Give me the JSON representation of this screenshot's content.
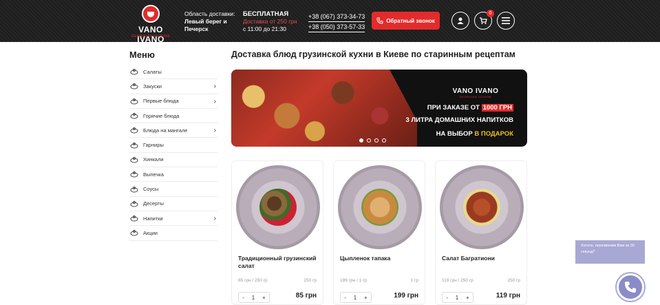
{
  "header": {
    "logo_text": "VANO IVANO",
    "logo_sub": "GEORGIAN CUISINE",
    "delivery_area_label": "Область доставки:",
    "delivery_area_value": "Левый берег и Печерск",
    "free_title": "БЕСПЛАТНАЯ",
    "free_condition": "Доставка от 250 грн",
    "free_hours": "с 11:00 до 21:30",
    "phone_1": "+38 (067) 373-34-73",
    "phone_2": "+38 (050) 373-57-33",
    "callback_label": "Обратный звонок",
    "cart_count": "0"
  },
  "sidebar": {
    "title": "Меню",
    "items": [
      {
        "label": "Салаты",
        "icon": "salad-icon",
        "arrow": false
      },
      {
        "label": "Закуски",
        "icon": "snacks-icon",
        "arrow": true
      },
      {
        "label": "Первые блюда",
        "icon": "soup-icon",
        "arrow": true
      },
      {
        "label": "Горячие блюда",
        "icon": "hot-dish-icon",
        "arrow": false
      },
      {
        "label": "Блюда на мангале",
        "icon": "grill-icon",
        "arrow": true
      },
      {
        "label": "Гарниры",
        "icon": "garnish-icon",
        "arrow": false
      },
      {
        "label": "Хинкали",
        "icon": "khinkali-icon",
        "arrow": false
      },
      {
        "label": "Выпечка",
        "icon": "pastry-icon",
        "arrow": false
      },
      {
        "label": "Соусы",
        "icon": "sauce-icon",
        "arrow": false
      },
      {
        "label": "Десерты",
        "icon": "dessert-icon",
        "arrow": false
      },
      {
        "label": "Напитки",
        "icon": "drinks-icon",
        "arrow": true
      },
      {
        "label": "Акции",
        "icon": "percent-icon",
        "arrow": false
      }
    ]
  },
  "main": {
    "title": "Доставка блюд грузинской кухни в Киеве по старинным рецептам"
  },
  "banner": {
    "logo_text": "VANO IVANO",
    "logo_sub": "GEORGIAN CUISINE",
    "line1_pre": "ПРИ ЗАКАЗЕ ОТ",
    "line1_hl": "1000 ГРН",
    "line2": "3 ЛИТРА ДОМАШНИХ НАПИТКОВ",
    "line3_pre": "НА ВЫБОР",
    "line3_hl": "В ПОДАРОК"
  },
  "products": [
    {
      "name": "Традиционный грузинский салат",
      "weight": "85 грн / 250 гр",
      "weight2": "250 гр",
      "qty": "1",
      "price": "85 грн"
    },
    {
      "name": "Цыпленок тапака",
      "weight": "199 грн / 1 гр",
      "weight2": "1 гр",
      "qty": "1",
      "price": "199 грн"
    },
    {
      "name": "Салат Багратиони",
      "weight": "119 грн / 250 гр",
      "weight2": "250 гр",
      "qty": "1",
      "price": "119 грн"
    }
  ],
  "qty_minus": "-",
  "qty_plus": "+",
  "callback_widget": {
    "text": "Хотите, перезвоним Вам за 30 секунд?"
  },
  "colors": {
    "accent": "#e32b2b",
    "header_bg": "#222222",
    "widget": "#8b8bc7"
  }
}
